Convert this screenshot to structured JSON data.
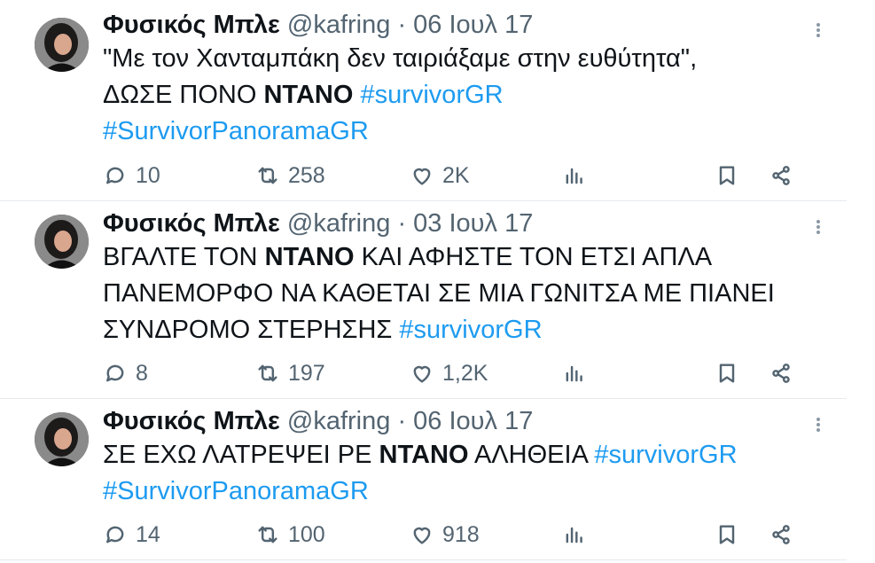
{
  "tweets": [
    {
      "name": "Φυσικός Μπλε",
      "handle": "@kafring",
      "separator": "·",
      "date": "06 Ιουλ 17",
      "text": [
        {
          "t": "\"Με τον Χανταμπάκη δεν ταιριάξαμε στην ευθύτητα\",\nΔΩΣΕ ΠΟΝΟ ",
          "s": "plain"
        },
        {
          "t": "ΝΤΑΝΟ",
          "s": "bold"
        },
        {
          "t": " ",
          "s": "plain"
        },
        {
          "t": "#survivorGR",
          "s": "tag"
        },
        {
          "t": "\n",
          "s": "plain"
        },
        {
          "t": "#SurvivorPanoramaGR",
          "s": "tag"
        }
      ],
      "replies": "10",
      "retweets": "258",
      "likes": "2K"
    },
    {
      "name": "Φυσικός Μπλε",
      "handle": "@kafring",
      "separator": "·",
      "date": "03 Ιουλ 17",
      "text": [
        {
          "t": "ΒΓΑΛΤΕ ΤΟΝ ",
          "s": "plain"
        },
        {
          "t": "ΝΤΑΝΟ",
          "s": "bold"
        },
        {
          "t": " ΚΑΙ ΑΦΗΣΤΕ ΤΟΝ ΕΤΣΙ ΑΠΛΑ\nΠΑΝΕΜΟΡΦΟ ΝΑ ΚΑΘΕΤΑΙ ΣΕ ΜΙΑ ΓΩΝΙΤΣΑ ΜΕ ΠΙΑΝΕΙ\nΣΥΝΔΡΟΜΟ ΣΤΕΡΗΣΗΣ ",
          "s": "plain"
        },
        {
          "t": "#survivorGR",
          "s": "tag"
        }
      ],
      "replies": "8",
      "retweets": "197",
      "likes": "1,2K"
    },
    {
      "name": "Φυσικός Μπλε",
      "handle": "@kafring",
      "separator": "·",
      "date": "06 Ιουλ 17",
      "text": [
        {
          "t": "ΣΕ ΕΧΩ ΛΑΤΡΕΨΕΙ ΡΕ ",
          "s": "plain"
        },
        {
          "t": "ΝΤΑΝΟ",
          "s": "bold"
        },
        {
          "t": " ΑΛΗΘΕΙΑ ",
          "s": "plain"
        },
        {
          "t": "#survivorGR",
          "s": "tag"
        },
        {
          "t": "\n",
          "s": "plain"
        },
        {
          "t": "#SurvivorPanoramaGR",
          "s": "tag"
        }
      ],
      "replies": "14",
      "retweets": "100",
      "likes": "918"
    }
  ],
  "colors": {
    "text": "#0f1419",
    "secondary": "#536471",
    "hashtag": "#1d9bf0",
    "divider": "#e6e9ec"
  },
  "icons": {
    "reply": "reply-icon",
    "retweet": "retweet-icon",
    "like": "heart-icon",
    "views": "views-icon",
    "bookmark": "bookmark-icon",
    "share": "share-icon",
    "more": "more-icon"
  }
}
